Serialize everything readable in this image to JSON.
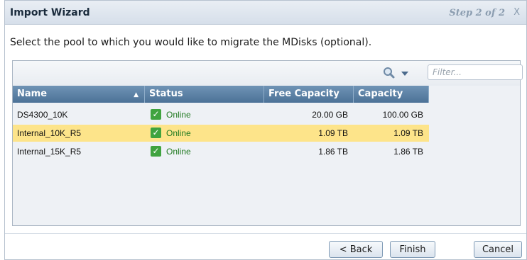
{
  "dialog": {
    "title": "Import Wizard",
    "step": "Step 2 of 2",
    "close_label": "X"
  },
  "instruction": "Select the pool to which you would like to migrate the MDisks (optional).",
  "toolbar": {
    "search_icon": "magnifier-icon",
    "filter_placeholder": "Filter..."
  },
  "table": {
    "columns": [
      "Name",
      "Status",
      "Free Capacity",
      "Capacity"
    ],
    "sort": {
      "column": "Name",
      "direction": "ascending"
    },
    "rows": [
      {
        "name": "DS4300_10K",
        "status": "Online",
        "free_capacity": "20.00 GB",
        "capacity": "100.00 GB",
        "selected": false
      },
      {
        "name": "Internal_10K_R5",
        "status": "Online",
        "free_capacity": "1.09 TB",
        "capacity": "1.09 TB",
        "selected": true
      },
      {
        "name": "Internal_15K_R5",
        "status": "Online",
        "free_capacity": "1.86 TB",
        "capacity": "1.86 TB",
        "selected": false
      }
    ]
  },
  "buttons": {
    "back": "< Back",
    "finish": "Finish",
    "cancel": "Cancel"
  },
  "colors": {
    "selected_row": "#fde48a",
    "header": "#5a80a5",
    "online": "#3fa33f"
  }
}
